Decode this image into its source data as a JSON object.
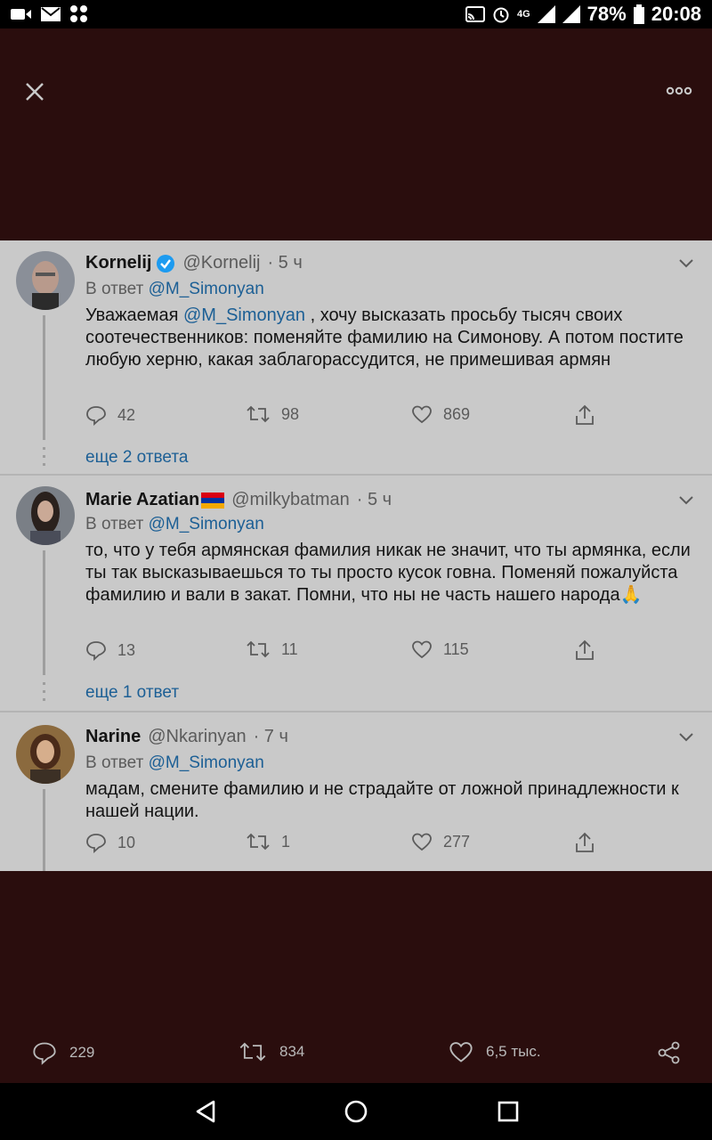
{
  "status_bar": {
    "battery": "78%",
    "time": "20:08",
    "network": "4G"
  },
  "top": {
    "close_icon": "close-icon",
    "more_icon": "more-horizontal-icon"
  },
  "replies": [
    {
      "name": "Kornelij",
      "verified": true,
      "flag": "",
      "handle": "@Kornelij",
      "time": "· 5 ч",
      "reply_prefix": "В ответ",
      "reply_to": "@M_Simonyan",
      "text_prefix": "Уважаемая ",
      "text_mention": "@M_Simonyan",
      "text_rest": " , хочу высказать просьбу тысяч своих соотечественников: поменяйте фамилию на Симонову. А потом постите любую херню, какая заблагорассудится, не примешивая армян",
      "replies_count": "42",
      "retweets_count": "98",
      "likes_count": "869",
      "more_replies": "еще 2 ответа"
    },
    {
      "name": "Marie Azatian",
      "verified": false,
      "flag": "armenia-flag",
      "handle": "@milkybatman",
      "time": "· 5 ч",
      "reply_prefix": "В ответ",
      "reply_to": "@M_Simonyan",
      "text_prefix": "",
      "text_mention": "",
      "text_rest": "то, что у тебя армянская фамилия никак не значит, что ты армянка, если ты так высказываешься то ты просто кусок говна. Поменяй пожалуйста фамилию и вали в закат. Помни, что ны не часть нашего народа",
      "emoji": "🙏",
      "replies_count": "13",
      "retweets_count": "11",
      "likes_count": "115",
      "more_replies": "еще 1 ответ"
    },
    {
      "name": "Narine",
      "verified": false,
      "flag": "",
      "handle": "@Nkarinyan",
      "time": "· 7 ч",
      "reply_prefix": "В ответ",
      "reply_to": "@M_Simonyan",
      "text_prefix": "",
      "text_mention": "",
      "text_rest": "мадам, смените фамилию и не страдайте от ложной принадлежности к нашей нации.",
      "replies_count": "10",
      "retweets_count": "1",
      "likes_count": "277",
      "more_replies": ""
    }
  ],
  "bottom_actions": {
    "replies": "229",
    "retweets": "834",
    "likes": "6,5 тыс."
  },
  "colors": {
    "overlay": "#2a0d0d",
    "panel": "#c9c9c9",
    "link": "#1c5f95",
    "verified": "#1d9bf0"
  }
}
